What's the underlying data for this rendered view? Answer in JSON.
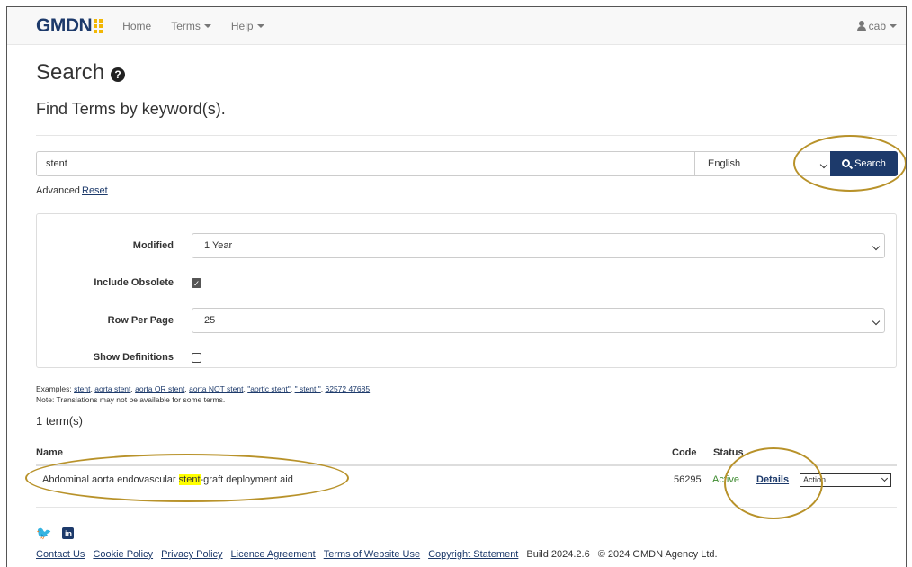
{
  "navbar": {
    "brand": "GMDN",
    "links": [
      {
        "label": "Home"
      },
      {
        "label": "Terms"
      },
      {
        "label": "Help"
      }
    ],
    "user": "cab"
  },
  "page": {
    "title": "Search",
    "subtitle": "Find Terms by keyword(s)."
  },
  "search": {
    "value": "stent",
    "language": "English",
    "button_label": "Search",
    "advanced_label": "Advanced",
    "reset_label": "Reset"
  },
  "filters": {
    "modified_label": "Modified",
    "modified_value": "1 Year",
    "include_obsolete_label": "Include Obsolete",
    "include_obsolete_checked": true,
    "rows_label": "Row Per Page",
    "rows_value": "25",
    "show_definitions_label": "Show Definitions",
    "show_definitions_checked": false
  },
  "examples": {
    "prefix": "Examples:",
    "items": [
      "stent",
      "aorta stent",
      "aorta OR stent",
      "aorta NOT stent",
      "\"aortic stent\"",
      "\" stent \"",
      "62572 47685"
    ],
    "note": "Note: Translations may not be available for some terms."
  },
  "results": {
    "count": "1 term(s)",
    "headers": {
      "name": "Name",
      "code": "Code",
      "status": "Status"
    },
    "rows": [
      {
        "name_before": "Abdominal aorta endovascular ",
        "name_highlight": "stent",
        "name_after": "-graft deployment aid",
        "code": "56295",
        "status": "Active",
        "details": "Details",
        "action": "Action"
      }
    ]
  },
  "footer": {
    "links": [
      "Contact Us",
      "Cookie Policy",
      "Privacy Policy",
      "Licence Agreement",
      "Terms of Website Use",
      "Copyright Statement"
    ],
    "build": "Build 2024.2.6",
    "copyright": "© 2024 GMDN Agency Ltd."
  },
  "colors": {
    "brand": "#1d3a6b",
    "accent": "#f2b705",
    "active_status": "#3c8a2e",
    "highlight": "#ffff00",
    "annotation": "#b8922a"
  }
}
